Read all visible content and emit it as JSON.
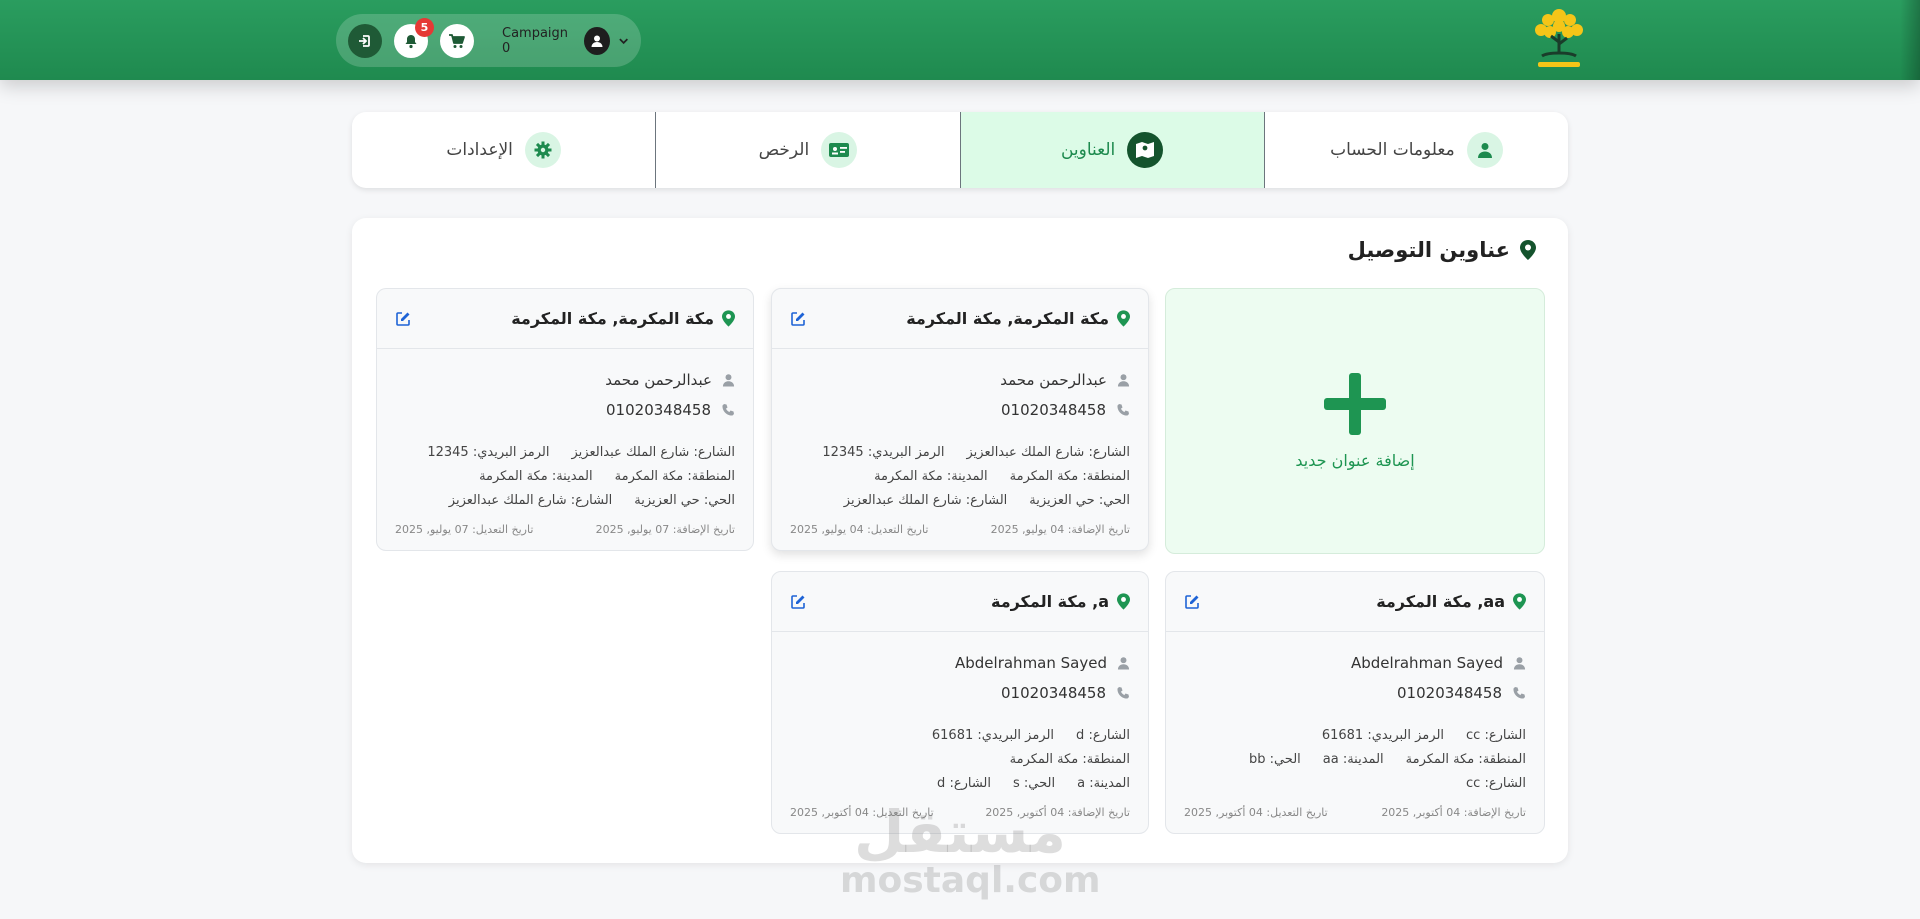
{
  "header": {
    "notifications_count": "5",
    "campaign_label": "Campaign 0"
  },
  "colors": {
    "primary": "#1e9552",
    "active_tab_bg": "#dcfbe7",
    "badge": "#e53935"
  },
  "tabs": [
    {
      "label": "معلومات الحساب",
      "icon": "user-icon"
    },
    {
      "label": "العناوين",
      "icon": "map-icon",
      "active": true
    },
    {
      "label": "الرخص",
      "icon": "id-card-icon"
    },
    {
      "label": "الإعدادات",
      "icon": "gear-icon"
    }
  ],
  "section": {
    "title": "عناوين التوصيل"
  },
  "new_address": {
    "label": "إضافة عنوان جديد"
  },
  "addresses": [
    {
      "title": "مكة المكرمة, مكة المكرمة",
      "name": "عبدالرحمن محمد",
      "phone": "01020348458",
      "line1": [
        "الشارع: شارع الملك عبدالعزيز",
        "الرمز البريدي: 12345"
      ],
      "line2": [
        "المنطقة: مكة المكرمة",
        "المدينة: مكة المكرمة"
      ],
      "line3": [
        "الحي: حي العزيزية",
        "الشارع: شارع الملك عبدالعزيز"
      ],
      "added": "تاريخ الإضافة: 04 يوليو, 2025",
      "modified": "تاريخ التعديل: 04 يوليو, 2025"
    },
    {
      "title": "مكة المكرمة, مكة المكرمة",
      "name": "عبدالرحمن محمد",
      "phone": "01020348458",
      "line1": [
        "الشارع: شارع الملك عبدالعزيز",
        "الرمز البريدي: 12345"
      ],
      "line2": [
        "المنطقة: مكة المكرمة",
        "المدينة: مكة المكرمة"
      ],
      "line3": [
        "الحي: حي العزيزية",
        "الشارع: شارع الملك عبدالعزيز"
      ],
      "added": "تاريخ الإضافة: 07 يوليو, 2025",
      "modified": "تاريخ التعديل: 07 يوليو, 2025"
    },
    {
      "title": "aa, مكة المكرمة",
      "name": "Abdelrahman Sayed",
      "phone": "01020348458",
      "line1": [
        "الشارع: cc",
        "الرمز البريدي: 61681"
      ],
      "line2": [
        "المنطقة: مكة المكرمة",
        "المدينة: aa",
        "الحي: bb"
      ],
      "line3": [
        "الشارع: cc"
      ],
      "added": "تاريخ الإضافة: 04 أكتوبر, 2025",
      "modified": "تاريخ التعديل: 04 أكتوبر, 2025"
    },
    {
      "title": "a, مكة المكرمة",
      "name": "Abdelrahman Sayed",
      "phone": "01020348458",
      "line1": [
        "الشارع: d",
        "الرمز البريدي: 61681",
        "المنطقة: مكة المكرمة"
      ],
      "line2": [
        "المدينة: a",
        "الحي: s",
        "الشارع: d"
      ],
      "added": "تاريخ الإضافة: 04 أكتوبر, 2025",
      "modified": "تاريخ التعديل: 04 أكتوبر, 2025"
    }
  ],
  "watermark": {
    "arabic": "مستقل",
    "latin": "mostaql.com"
  }
}
